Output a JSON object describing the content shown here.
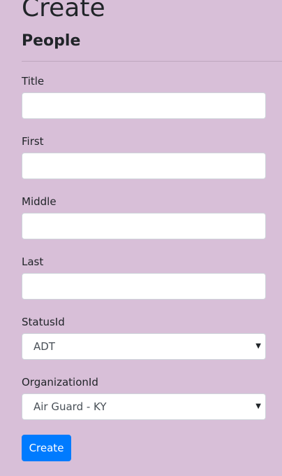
{
  "page": {
    "title": "Create",
    "section": "People"
  },
  "form": {
    "fields": [
      {
        "label": "Title",
        "value": ""
      },
      {
        "label": "First",
        "value": ""
      },
      {
        "label": "Middle",
        "value": ""
      },
      {
        "label": "Last",
        "value": ""
      }
    ],
    "selects": [
      {
        "label": "StatusId",
        "selected": "ADT"
      },
      {
        "label": "OrganizationId",
        "selected": "Air Guard - KY"
      }
    ],
    "submit_label": "Create"
  },
  "icons": {
    "select_arrow": "triangle-down-icon"
  },
  "colors": {
    "background": "#d8bfd8",
    "primary": "#007bff"
  }
}
